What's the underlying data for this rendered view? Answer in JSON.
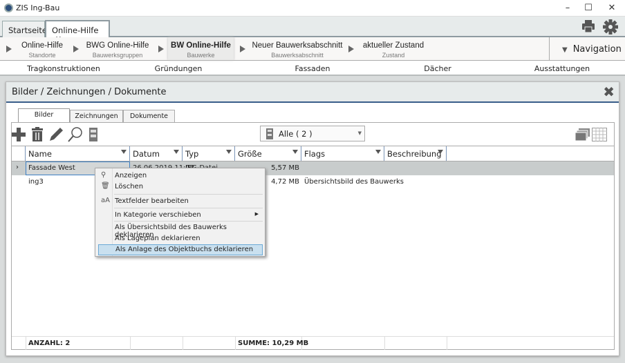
{
  "window": {
    "title": "ZIS Ing-Bau",
    "minimize": "–",
    "maximize": "☐",
    "close": "✕"
  },
  "tabs": [
    {
      "label": "Startseite"
    },
    {
      "label": "Online-Hilfe",
      "close": "✖"
    }
  ],
  "breadcrumbs": [
    {
      "title": "Online-Hilfe",
      "subtitle": "Standorte"
    },
    {
      "title": "BWG Online-Hilfe",
      "subtitle": "Bauwerksgruppen"
    },
    {
      "title": "BW Online-Hilfe",
      "subtitle": "Bauwerke",
      "current": true
    },
    {
      "title": "Neuer Bauwerksabschnitt",
      "subtitle": "Bauwerksabschnitt"
    },
    {
      "title": "aktueller Zustand",
      "subtitle": "Zustand"
    }
  ],
  "navigation": {
    "label": "Navigation"
  },
  "categories": [
    "Tragkonstruktionen",
    "Gründungen",
    "Fassaden",
    "Dächer",
    "Ausstattungen"
  ],
  "panel": {
    "title": "Bilder / Zeichnungen / Dokumente",
    "tabs": [
      "Bilder",
      "Zeichnungen",
      "Dokumente"
    ],
    "filter": {
      "selected": "Alle ( 2 )"
    },
    "columns": [
      "Name",
      "Datum",
      "Typ",
      "Größe",
      "Flags",
      "Beschreibung"
    ],
    "rows": [
      {
        "name": "Fassade West",
        "datum": "26.06.2019 11:03",
        "typ": "JPG-Datei",
        "groesse": "5,57 MB",
        "flags": "",
        "selected": true
      },
      {
        "name": "ing3",
        "datum": "",
        "typ": "",
        "groesse": "4,72 MB",
        "flags": "Übersichtsbild des Bauwerks"
      }
    ],
    "footer": {
      "count": "ANZAHL: 2",
      "sum": "SUMME: 10,29 MB"
    }
  },
  "context_menu": [
    {
      "label": "Anzeigen",
      "icon": "magnifier-icon"
    },
    {
      "label": "Löschen",
      "icon": "trash-icon"
    },
    {
      "label": "Textfelder bearbeiten",
      "icon": "text-edit-icon"
    },
    {
      "label": "In Kategorie verschieben",
      "submenu": true
    },
    {
      "label": "Als Übersichtsbild des Bauwerks deklarieren"
    },
    {
      "label": "Als Lageplan deklarieren"
    },
    {
      "label": "Als Anlage des Objektbuchs deklarieren",
      "highlighted": true
    }
  ],
  "colors": {
    "accent": "#385d8a",
    "selected_row": "#c8cccc",
    "menu_highlight": "#c9e0ef"
  }
}
